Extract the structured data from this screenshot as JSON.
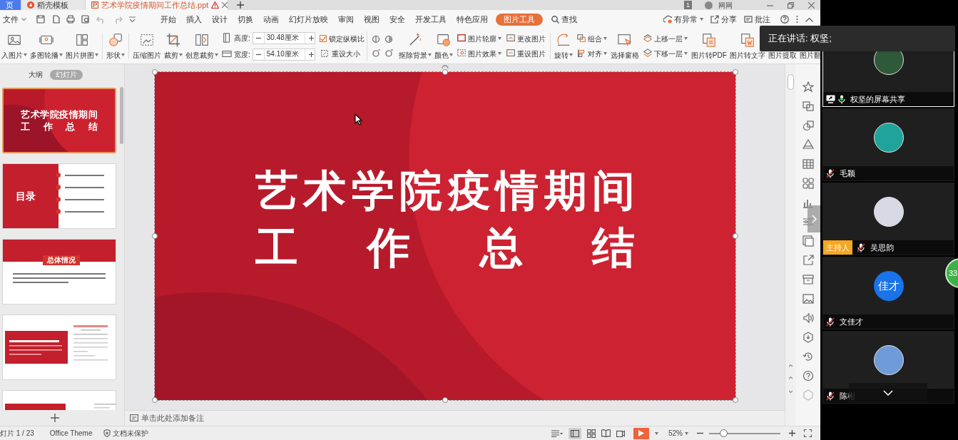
{
  "doc_tabs": [
    {
      "label": "页",
      "kind": "home",
      "selected": false
    },
    {
      "label": "稻壳模板",
      "kind": "template",
      "selected": false
    },
    {
      "label": "艺术学院疫情期间工作总结.ppt",
      "kind": "file",
      "selected": true
    }
  ],
  "title_bar": {
    "window_count": "1",
    "user_name": "网网"
  },
  "menu": {
    "file": "文件",
    "tabs": [
      {
        "label": "开始",
        "selected": false
      },
      {
        "label": "插入",
        "selected": false
      },
      {
        "label": "设计",
        "selected": false
      },
      {
        "label": "切换",
        "selected": false
      },
      {
        "label": "动画",
        "selected": false
      },
      {
        "label": "幻灯片放映",
        "selected": false
      },
      {
        "label": "审阅",
        "selected": false
      },
      {
        "label": "视图",
        "selected": false
      },
      {
        "label": "安全",
        "selected": false
      },
      {
        "label": "开发工具",
        "selected": false
      },
      {
        "label": "特色应用",
        "selected": false
      },
      {
        "label": "图片工具",
        "selected": true
      }
    ],
    "search": "查找",
    "actions": [
      "有异常",
      "分享",
      "批注"
    ]
  },
  "ribbon": [
    {
      "kind": "large",
      "label": "入图片",
      "dropdown": true
    },
    {
      "kind": "large",
      "label": "多图轮播",
      "dropdown": true
    },
    {
      "kind": "large",
      "label": "图片拼图",
      "dropdown": true
    },
    {
      "kind": "sep"
    },
    {
      "kind": "large",
      "label": "形状",
      "dropdown": true
    },
    {
      "kind": "sep"
    },
    {
      "kind": "large",
      "label": "压缩图片",
      "dropdown": false
    },
    {
      "kind": "large",
      "label": "裁剪",
      "dropdown": true
    },
    {
      "kind": "large",
      "label": "创意裁剪",
      "dropdown": true
    },
    {
      "kind": "size",
      "rows": [
        {
          "label": "高度:",
          "value": "30.48厘米"
        },
        {
          "label": "宽度:",
          "value": "54.10厘米"
        }
      ]
    },
    {
      "kind": "check",
      "rows": [
        {
          "kind": "checkbox",
          "label": "锁定纵横比",
          "checked": true
        },
        {
          "kind": "button",
          "label": "重设大小"
        }
      ]
    },
    {
      "kind": "icons"
    },
    {
      "kind": "large",
      "label": "抠除背景",
      "dropdown": true
    },
    {
      "kind": "large",
      "label": "颜色",
      "dropdown": true
    },
    {
      "kind": "pair",
      "rows": [
        {
          "label": "图片轮廓",
          "dropdown": true
        },
        {
          "label": "图片效果",
          "dropdown": true
        }
      ]
    },
    {
      "kind": "pair",
      "rows": [
        {
          "label": "更改图片",
          "dropdown": false
        },
        {
          "label": "重设图片",
          "dropdown": false
        }
      ]
    },
    {
      "kind": "sep"
    },
    {
      "kind": "large",
      "label": "旋转",
      "dropdown": true
    },
    {
      "kind": "pair",
      "rows": [
        {
          "label": "组合",
          "dropdown": true
        },
        {
          "label": "对齐",
          "dropdown": true
        }
      ]
    },
    {
      "kind": "large",
      "label": "选择窗格",
      "dropdown": false
    },
    {
      "kind": "pair",
      "rows": [
        {
          "label": "上移一层",
          "dropdown": true
        },
        {
          "label": "下移一层",
          "dropdown": true
        }
      ]
    },
    {
      "kind": "large",
      "label": "图片转PDF",
      "dropdown": false
    },
    {
      "kind": "large",
      "label": "图片转文字",
      "dropdown": false
    },
    {
      "kind": "large",
      "label": "图片提取",
      "dropdown": false
    },
    {
      "kind": "large",
      "label": "图片翻",
      "dropdown": false
    }
  ],
  "slides_panel": {
    "view_tabs": [
      {
        "label": "大纲",
        "selected": false
      },
      {
        "label": "幻灯片",
        "selected": true
      }
    ],
    "thumbnails": [
      {
        "kind": "title",
        "selected": true,
        "title_lines": [
          "艺术学院疫情期间",
          "工作总结"
        ]
      },
      {
        "kind": "toc",
        "selected": false,
        "heading": "目录"
      },
      {
        "kind": "section",
        "selected": false,
        "heading": "总体情况"
      },
      {
        "kind": "split",
        "selected": false
      },
      {
        "kind": "partial",
        "selected": false
      }
    ]
  },
  "slide": {
    "title_lines": [
      "艺术学院疫情期间",
      "工作总结"
    ]
  },
  "notes_placeholder": "单击此处添加备注",
  "status_bar": {
    "slide_counter": "灯片 1 / 23",
    "theme": "Office Theme",
    "protection": "文档未保护",
    "zoom": "52%",
    "zoom_slider": {
      "level": 0.2
    }
  },
  "meeting": {
    "speaking": "正在讲话: 权坚;",
    "participant_count": "33",
    "participants": [
      {
        "name": "权坚的屏幕共享",
        "kind": "screen",
        "muted": false,
        "highlighted": true
      },
      {
        "name": "毛颖",
        "kind": "person",
        "muted": true,
        "highlighted": false
      },
      {
        "name": "吴思韵",
        "kind": "host",
        "host_badge": "主持人",
        "muted": true,
        "highlighted": false
      },
      {
        "name": "文佳才",
        "kind": "person",
        "muted": true,
        "highlighted": false,
        "avatar_text": "佳才"
      },
      {
        "name": "陈彬",
        "kind": "person",
        "muted": true,
        "highlighted": false
      }
    ]
  }
}
